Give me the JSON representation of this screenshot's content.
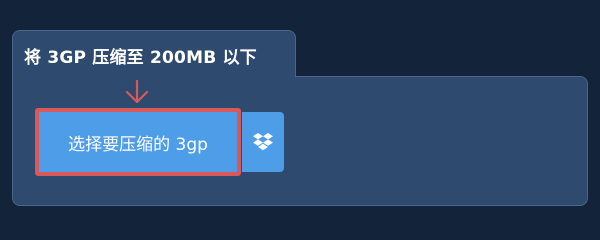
{
  "panel": {
    "title": "将 3GP 压缩至 200MB 以下"
  },
  "upload": {
    "choose_file_label": "选择要压缩的 3gp",
    "dropbox_icon": "dropbox-icon",
    "arrow_icon": "arrow-down-icon"
  },
  "colors": {
    "page_background": "#13233a",
    "panel_background": "#2e4a6e",
    "button_blue": "#4e9de9",
    "highlight_red": "#d9595a"
  }
}
